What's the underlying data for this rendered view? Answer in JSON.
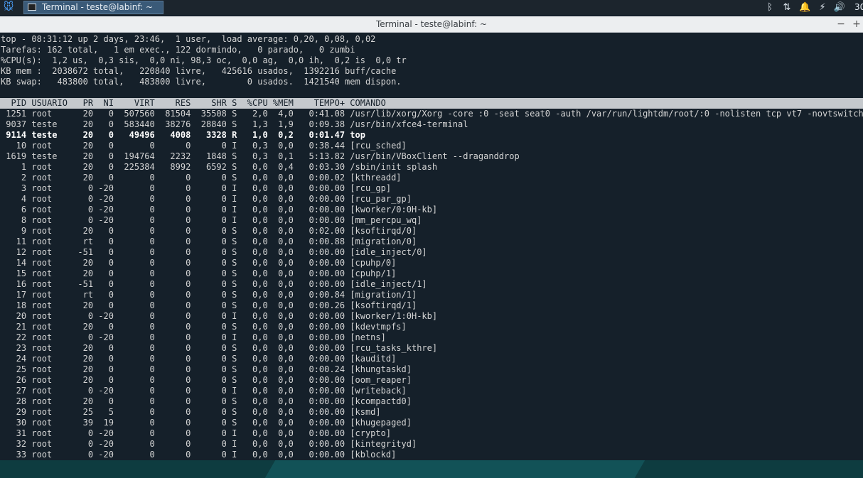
{
  "taskbar": {
    "task_label": "Terminal - teste@labinf: ~",
    "clock": "30",
    "icons": [
      "xfce-mouse-icon",
      "terminal-icon",
      "bluetooth-icon",
      "network-icon",
      "notification-bell-icon",
      "power-icon",
      "volume-icon"
    ]
  },
  "window": {
    "title": "Terminal - teste@labinf: ~",
    "buttons": [
      "−",
      "+"
    ]
  },
  "top": {
    "summary": [
      "top - 08:31:12 up 2 days, 23:46,  1 user,  load average: 0,20, 0,08, 0,02",
      "Tarefas: 162 total,   1 em exec., 122 dormindo,   0 parado,   0 zumbi",
      "%CPU(s):  1,2 us,  0,3 sis,  0,0 ni, 98,3 oc,  0,0 ag,  0,0 ih,  0,2 is  0,0 tr",
      "KB mem :  2038672 total,   220840 livre,   425616 usados,  1392216 buff/cache",
      "KB swap:   483800 total,   483800 livre,        0 usados.  1421540 mem dispon."
    ],
    "header": "  PID USUARIO   PR  NI    VIRT    RES    SHR S  %CPU %MEM    TEMPO+ COMANDO",
    "rows": [
      " 1251 root      20   0  507560  81504  35508 S   2,0  4,0   0:41.08 /usr/lib/xorg/Xorg -core :0 -seat seat0 -auth /var/run/lightdm/root/:0 -nolisten tcp vt7 -novtswitch",
      " 9037 teste     20   0  583440  38276  28840 S   1,3  1,9   0:09.38 /usr/bin/xfce4-terminal",
      " 9114 teste     20   0   49496   4008   3328 R   1,0  0,2   0:01.47 top",
      "   10 root      20   0       0      0      0 I   0,3  0,0   0:38.44 [rcu_sched]",
      " 1619 teste     20   0  194764   2232   1848 S   0,3  0,1   5:13.82 /usr/bin/VBoxClient --draganddrop",
      "    1 root      20   0  225384   8992   6592 S   0,0  0,4   0:03.30 /sbin/init splash",
      "    2 root      20   0       0      0      0 S   0,0  0,0   0:00.02 [kthreadd]",
      "    3 root       0 -20       0      0      0 I   0,0  0,0   0:00.00 [rcu_gp]",
      "    4 root       0 -20       0      0      0 I   0,0  0,0   0:00.00 [rcu_par_gp]",
      "    6 root       0 -20       0      0      0 I   0,0  0,0   0:00.00 [kworker/0:0H-kb]",
      "    8 root       0 -20       0      0      0 I   0,0  0,0   0:00.00 [mm_percpu_wq]",
      "    9 root      20   0       0      0      0 S   0,0  0,0   0:02.00 [ksoftirqd/0]",
      "   11 root      rt   0       0      0      0 S   0,0  0,0   0:00.88 [migration/0]",
      "   12 root     -51   0       0      0      0 S   0,0  0,0   0:00.00 [idle_inject/0]",
      "   14 root      20   0       0      0      0 S   0,0  0,0   0:00.00 [cpuhp/0]",
      "   15 root      20   0       0      0      0 S   0,0  0,0   0:00.00 [cpuhp/1]",
      "   16 root     -51   0       0      0      0 S   0,0  0,0   0:00.00 [idle_inject/1]",
      "   17 root      rt   0       0      0      0 S   0,0  0,0   0:00.84 [migration/1]",
      "   18 root      20   0       0      0      0 S   0,0  0,0   0:00.26 [ksoftirqd/1]",
      "   20 root       0 -20       0      0      0 I   0,0  0,0   0:00.00 [kworker/1:0H-kb]",
      "   21 root      20   0       0      0      0 S   0,0  0,0   0:00.00 [kdevtmpfs]",
      "   22 root       0 -20       0      0      0 I   0,0  0,0   0:00.00 [netns]",
      "   23 root      20   0       0      0      0 S   0,0  0,0   0:00.00 [rcu_tasks_kthre]",
      "   24 root      20   0       0      0      0 S   0,0  0,0   0:00.00 [kauditd]",
      "   25 root      20   0       0      0      0 S   0,0  0,0   0:00.24 [khungtaskd]",
      "   26 root      20   0       0      0      0 S   0,0  0,0   0:00.00 [oom_reaper]",
      "   27 root       0 -20       0      0      0 I   0,0  0,0   0:00.00 [writeback]",
      "   28 root      20   0       0      0      0 S   0,0  0,0   0:00.00 [kcompactd0]",
      "   29 root      25   5       0      0      0 S   0,0  0,0   0:00.00 [ksmd]",
      "   30 root      39  19       0      0      0 S   0,0  0,0   0:00.00 [khugepaged]",
      "   31 root       0 -20       0      0      0 I   0,0  0,0   0:00.00 [crypto]",
      "   32 root       0 -20       0      0      0 I   0,0  0,0   0:00.00 [kintegrityd]",
      "   33 root       0 -20       0      0      0 I   0,0  0,0   0:00.00 [kblockd]"
    ],
    "highlight_row_index": 2
  },
  "colors": {
    "terminal_bg": "#15202a",
    "terminal_fg": "#d4d4d4",
    "header_bg": "#c5c9cd",
    "panel_bg": "#1c252d",
    "task_active": "#3a5a78"
  }
}
